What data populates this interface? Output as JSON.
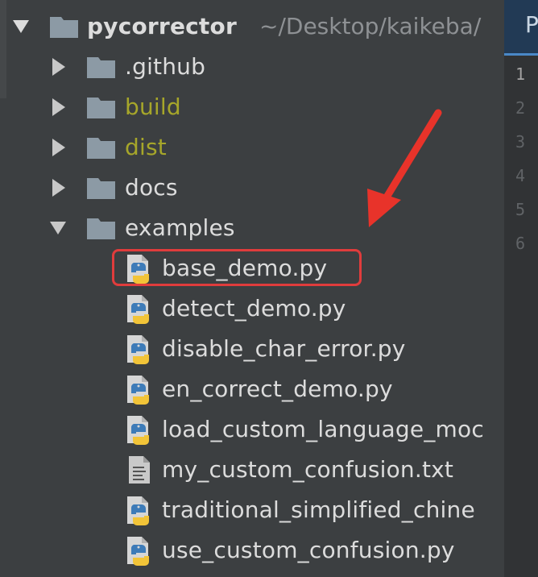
{
  "project": {
    "name": "pycorrector",
    "path": "~/Desktop/kaikeba/"
  },
  "tree": [
    {
      "label": ".github",
      "kind": "folder",
      "depth": 1,
      "state": "collapsed",
      "excluded": false
    },
    {
      "label": "build",
      "kind": "folder",
      "depth": 1,
      "state": "collapsed",
      "excluded": true
    },
    {
      "label": "dist",
      "kind": "folder",
      "depth": 1,
      "state": "collapsed",
      "excluded": true
    },
    {
      "label": "docs",
      "kind": "folder",
      "depth": 1,
      "state": "collapsed",
      "excluded": false
    },
    {
      "label": "examples",
      "kind": "folder",
      "depth": 1,
      "state": "expanded",
      "excluded": false
    },
    {
      "label": "base_demo.py",
      "kind": "python-file",
      "depth": 2,
      "highlighted": true
    },
    {
      "label": "detect_demo.py",
      "kind": "python-file",
      "depth": 2
    },
    {
      "label": "disable_char_error.py",
      "kind": "python-file",
      "depth": 2
    },
    {
      "label": "en_correct_demo.py",
      "kind": "python-file",
      "depth": 2
    },
    {
      "label": "load_custom_language_moc",
      "kind": "python-file",
      "depth": 2
    },
    {
      "label": "my_custom_confusion.txt",
      "kind": "text-file",
      "depth": 2
    },
    {
      "label": "traditional_simplified_chine",
      "kind": "python-file",
      "depth": 2
    },
    {
      "label": "use_custom_confusion.py",
      "kind": "python-file",
      "depth": 2
    }
  ],
  "editor": {
    "tab_label": "P",
    "line_numbers": [
      "1",
      "2",
      "3",
      "4",
      "5",
      "6"
    ],
    "current_line": "1"
  },
  "colors": {
    "tree_background": "#3c3f41",
    "text": "#dcdcdc",
    "excluded_text": "#a6a62a",
    "path_text": "#8e9194",
    "folder_icon": "#8c9aa5",
    "highlight_border": "#e03c3c",
    "annotation_arrow": "#e8332a",
    "editor_tab_active": "#223a55"
  },
  "icons": {
    "expanded": "triangle-down-icon",
    "collapsed": "triangle-right-icon",
    "folder": "folder-icon",
    "python-file": "python-file-icon",
    "text-file": "text-file-icon"
  }
}
